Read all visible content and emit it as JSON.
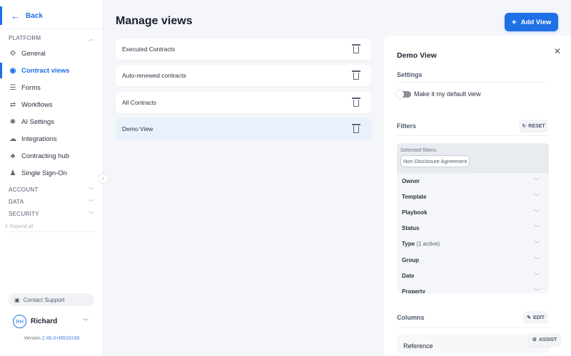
{
  "sidebar": {
    "back_label": "Back",
    "sections": {
      "platform": "PLATFORM",
      "account": "ACCOUNT",
      "data": "DATA",
      "security": "SECURITY"
    },
    "items": [
      {
        "label": "General",
        "icon": "gear-icon"
      },
      {
        "label": "Contract views",
        "icon": "eye-icon",
        "active": true
      },
      {
        "label": "Forms",
        "icon": "list-icon"
      },
      {
        "label": "Workflows",
        "icon": "workflow-icon"
      },
      {
        "label": "AI Settings",
        "icon": "chip-icon"
      },
      {
        "label": "Integrations",
        "icon": "puzzle-icon"
      },
      {
        "label": "Contracting hub",
        "icon": "hub-icon"
      },
      {
        "label": "Single Sign-On",
        "icon": "users-icon"
      }
    ],
    "expand_all": "Expand all",
    "contact_support": "Contact Support",
    "user": {
      "initials": "RH",
      "name": "Richard"
    },
    "version_label": "Version",
    "version": "2.46.0+f8528186"
  },
  "main": {
    "title": "Manage views",
    "add_view_label": "Add View",
    "views": [
      {
        "name": "Executed Contracts"
      },
      {
        "name": "Auto-renewed contracts"
      },
      {
        "name": "All Contracts"
      },
      {
        "name": "Demo View",
        "selected": true
      }
    ]
  },
  "panel": {
    "title": "Demo View",
    "settings_label": "Settings",
    "default_toggle_label": "Make it my default view",
    "default_toggle_on": false,
    "filters_label": "Filters",
    "reset_label": "RESET",
    "selected_filters_label": "Selected filters:",
    "selected_chip": "Non Disclosure Agreement",
    "filters": [
      {
        "label": "Owner",
        "extra": ""
      },
      {
        "label": "Template",
        "extra": ""
      },
      {
        "label": "Playbook",
        "extra": ""
      },
      {
        "label": "Status",
        "extra": ""
      },
      {
        "label": "Type",
        "extra": "(1 active)"
      },
      {
        "label": "Group",
        "extra": ""
      },
      {
        "label": "Date",
        "extra": ""
      },
      {
        "label": "Property",
        "extra": ""
      }
    ],
    "columns_label": "Columns",
    "edit_label": "EDIT",
    "columns": [
      {
        "name": "Reference"
      }
    ],
    "assist_label": "ASSIST"
  },
  "colors": {
    "accent": "#1f6fe5",
    "selected_row": "#e9f1fd",
    "background": "#f4f6fa"
  }
}
